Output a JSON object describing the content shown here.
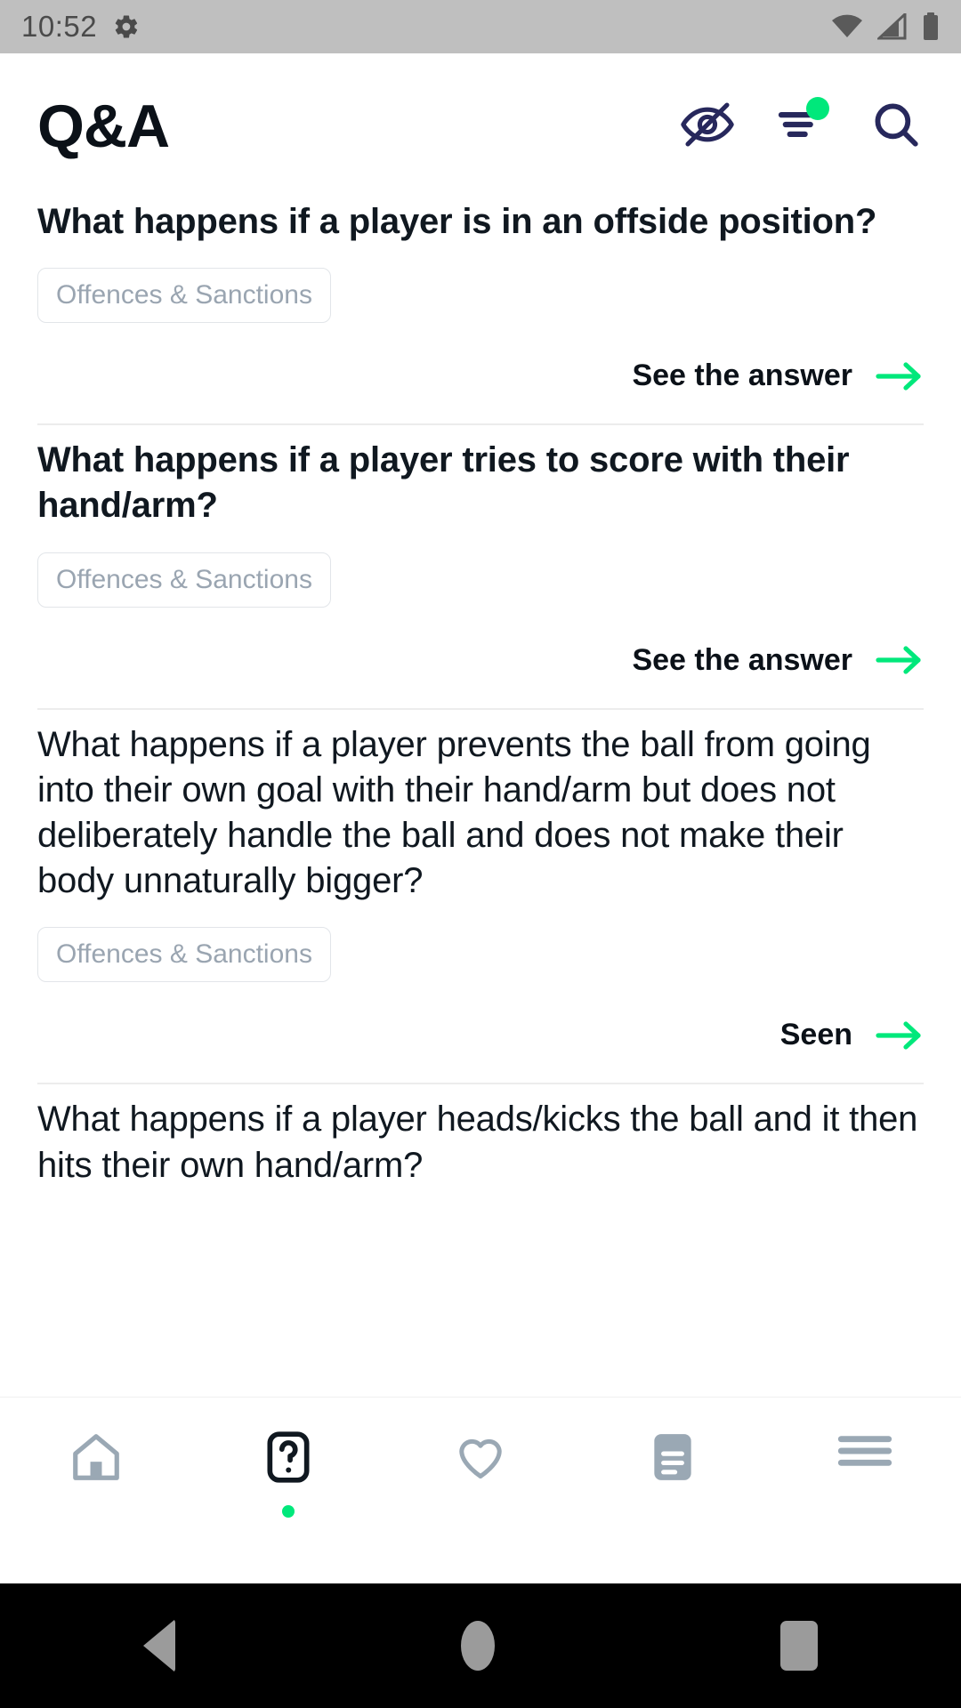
{
  "status_bar": {
    "time": "10:52",
    "icons": [
      "gear-icon",
      "wifi-icon",
      "cellular-signal-icon",
      "battery-icon"
    ],
    "background_color": "#bfbfbf"
  },
  "header": {
    "title": "Q&A",
    "actions": [
      {
        "name": "hide-answers-icon",
        "icon": "eye-slash-icon",
        "badge": false
      },
      {
        "name": "filter-icon",
        "icon": "filter-lines-icon",
        "badge": true,
        "badge_color": "#00E87B"
      },
      {
        "name": "search-icon",
        "icon": "magnifier-icon",
        "badge": false
      }
    ],
    "icon_color": "#27285C"
  },
  "theme": {
    "accent_green": "#00E87B",
    "text_dark": "#0b1118",
    "tag_text": "#9aa5b1",
    "tag_border": "#e2e5e9",
    "divider": "#ececec",
    "tab_inactive": "#9aa8b4",
    "tab_active": "#101820"
  },
  "questions": [
    {
      "text": "What happens if a player is in an offside position?",
      "tag": "Offences & Sanctions",
      "action_label": "See the answer",
      "seen": false
    },
    {
      "text": "What happens if a player tries to score with their hand/arm?",
      "tag": "Offences & Sanctions",
      "action_label": "See the answer",
      "seen": false
    },
    {
      "text": "What happens if a player prevents the ball from going into their own goal with their hand/arm but does not deliberately handle the ball and does not make their body unnaturally bigger?",
      "tag": "Offences & Sanctions",
      "action_label": "Seen",
      "seen": true
    },
    {
      "text": "What happens if a player heads/kicks the ball and it then hits their own hand/arm?",
      "tag": "",
      "action_label": "",
      "seen": true
    }
  ],
  "tabbar": {
    "items": [
      {
        "name": "tab-home",
        "icon": "home-icon",
        "active": false
      },
      {
        "name": "tab-qa",
        "icon": "question-box-icon",
        "active": true
      },
      {
        "name": "tab-favourites",
        "icon": "heart-icon",
        "active": false
      },
      {
        "name": "tab-news",
        "icon": "document-icon",
        "active": false
      },
      {
        "name": "tab-more",
        "icon": "menu-lines-icon",
        "active": false
      }
    ]
  },
  "android_nav": {
    "buttons": [
      "back-button",
      "home-button",
      "recents-button"
    ]
  }
}
